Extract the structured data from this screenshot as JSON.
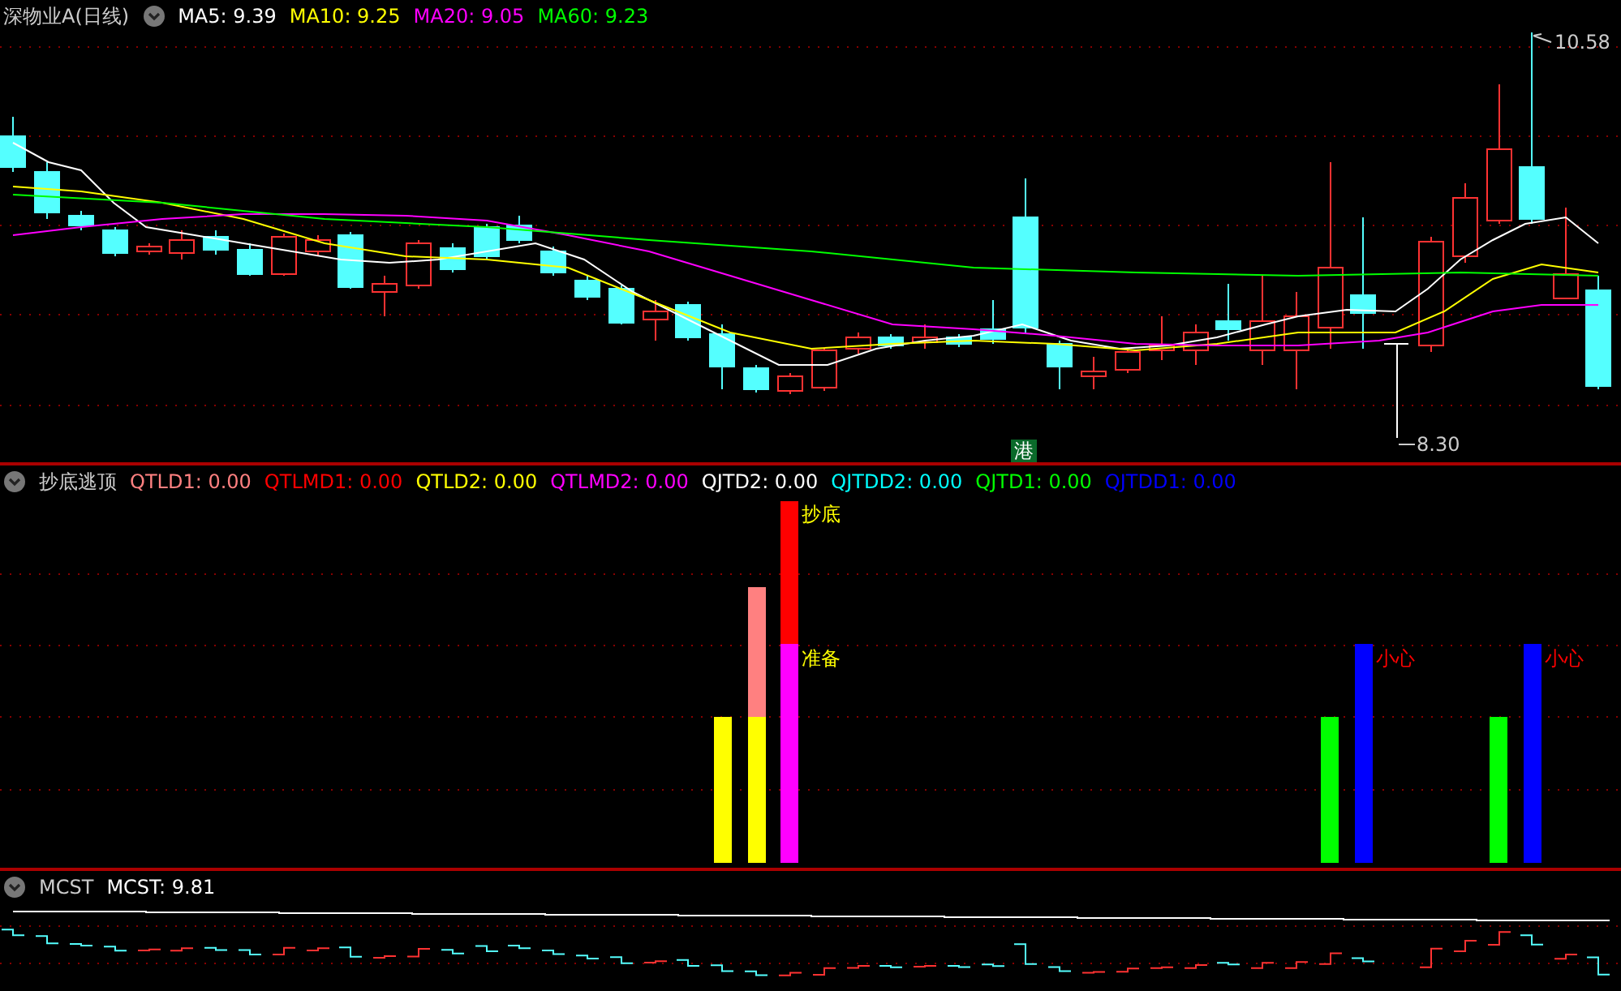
{
  "main_header": {
    "title": "深物业A(日线)",
    "values": [
      {
        "label": "MA5: 9.39",
        "color": "#ffffff"
      },
      {
        "label": "MA10: 9.25",
        "color": "#ffff00"
      },
      {
        "label": "MA20: 9.05",
        "color": "#ff00ff"
      },
      {
        "label": "MA60: 9.23",
        "color": "#00ff00"
      }
    ]
  },
  "price_chart": {
    "high_label": "10.58",
    "low_label": "8.30",
    "tag": "港"
  },
  "indicator_header": {
    "title": "抄底逃顶",
    "values": [
      {
        "label": "QTLD1: 0.00",
        "color": "#ff8080"
      },
      {
        "label": "QTLMD1: 0.00",
        "color": "#ff0000"
      },
      {
        "label": "QTLD2: 0.00",
        "color": "#ffff00"
      },
      {
        "label": "QTLMD2: 0.00",
        "color": "#ff00ff"
      },
      {
        "label": "QJTD2: 0.00",
        "color": "#ffffff"
      },
      {
        "label": "QJTDD2: 0.00",
        "color": "#00ffff"
      },
      {
        "label": "QJTD1: 0.00",
        "color": "#00ff00"
      },
      {
        "label": "QJTDD1: 0.00",
        "color": "#0000ff"
      }
    ]
  },
  "indicator_chart": {
    "labels": [
      {
        "text": "抄底",
        "color": "#ffff00"
      },
      {
        "text": "准备",
        "color": "#ffff00"
      },
      {
        "text": "小心",
        "color": "#ff0000"
      },
      {
        "text": "小心",
        "color": "#ff0000"
      }
    ]
  },
  "mcst_header": {
    "title": "MCST",
    "values": [
      {
        "label": "MCST: 9.81",
        "color": "#ffffff"
      }
    ]
  }
}
